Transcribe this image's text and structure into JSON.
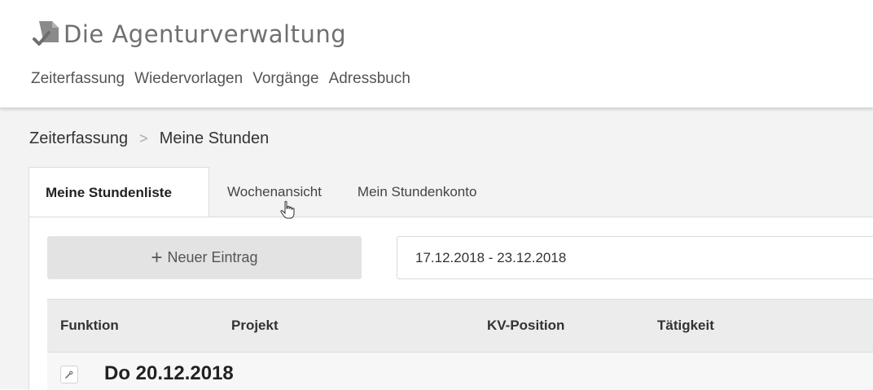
{
  "app": {
    "title_first": "Die",
    "title_rest": "Agenturverwaltung"
  },
  "topnav": {
    "items": [
      {
        "label": "Zeiterfassung"
      },
      {
        "label": "Wiedervorlagen"
      },
      {
        "label": "Vorgänge"
      },
      {
        "label": "Adressbuch"
      }
    ]
  },
  "breadcrumb": {
    "parent": "Zeiterfassung",
    "separator": ">",
    "current": "Meine Stunden"
  },
  "tabs": [
    {
      "label": "Meine Stundenliste",
      "active": true
    },
    {
      "label": "Wochenansicht",
      "active": false
    },
    {
      "label": "Mein Stundenkonto",
      "active": false
    }
  ],
  "toolbar": {
    "new_entry_icon": "+",
    "new_entry_label": "Neuer Eintrag",
    "date_range": "17.12.2018 - 23.12.2018"
  },
  "table": {
    "columns": [
      "Funktion",
      "Projekt",
      "KV-Position",
      "Tätigkeit"
    ],
    "group_label": "Do 20.12.2018"
  },
  "colors": {
    "content_bg": "#f3f3f3",
    "table_header_bg": "#ececec",
    "button_bg": "#e3e3e3"
  }
}
